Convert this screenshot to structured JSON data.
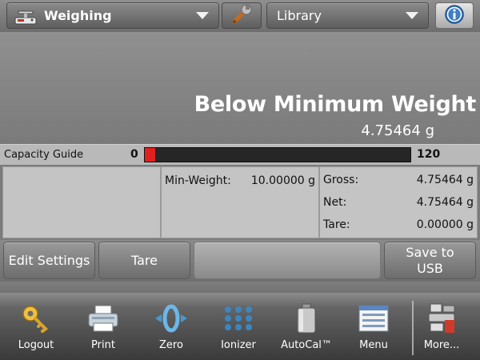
{
  "header": {
    "app_name": "Weighing",
    "library_label": "Library",
    "icons": [
      "scale-icon",
      "wrench-icon",
      "info-icon"
    ]
  },
  "display": {
    "status": "Below Minimum Weight",
    "reading": "4.75464 g"
  },
  "capacity": {
    "label": "Capacity Guide",
    "min": "0",
    "max": "120",
    "fill_fraction": 0.04
  },
  "info": {
    "min_weight_label": "Min-Weight:",
    "min_weight_value": "10.00000 g",
    "gross_label": "Gross:",
    "gross_value": "4.75464 g",
    "net_label": "Net:",
    "net_value": "4.75464 g",
    "tare_label": "Tare:",
    "tare_value": "0.00000 g"
  },
  "actions": {
    "edit_settings": "Edit Settings",
    "tare": "Tare",
    "save_usb_line1": "Save to",
    "save_usb_line2": "USB"
  },
  "toolbar": {
    "logout": "Logout",
    "print": "Print",
    "zero": "Zero",
    "ionizer": "Ionizer",
    "autocal": "AutoCal™",
    "menu": "Menu",
    "more": "More..."
  },
  "colors": {
    "bar_fill": "#e02020",
    "bar_bg": "#262626"
  }
}
